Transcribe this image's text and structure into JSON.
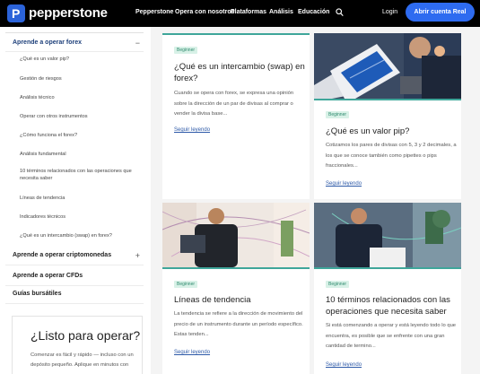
{
  "nav": {
    "brand": "pepperstone",
    "logo_letter": "P",
    "links": [
      "Pepperstone",
      "Opera con nosotros",
      "Plataformas",
      "Análisis",
      "Educación"
    ],
    "login": "Login",
    "cta": "Abrir cuenta Real"
  },
  "sidebar": {
    "sections": [
      {
        "label": "Aprende a operar forex",
        "toggle": "−",
        "expanded": true
      },
      {
        "label": "Aprende a operar criptomonedas",
        "toggle": "+"
      },
      {
        "label": "Aprende a operar CFDs",
        "toggle": ""
      },
      {
        "label": "Guías bursátiles",
        "toggle": ""
      }
    ],
    "items": [
      "¿Qué es un valor pip?",
      "Gestión de riesgos",
      "Análisis técnico",
      "Operar con otros instrumentos",
      "¿Cómo funciona el forex?",
      "Análisis fundamental",
      "10 términos relacionados con las operaciones que necesita saber",
      "Líneas de tendencia",
      "Indicadores técnicos",
      "¿Qué es un intercambio (swap) en forex?"
    ],
    "promo": {
      "title": "¿Listo para operar?",
      "text": "Comenzar es fácil y rápido — incluso con un depósito pequeño. Aplique en minutos con"
    }
  },
  "articles": [
    {
      "badge": "Beginner",
      "title": "¿Qué es un intercambio (swap) en forex?",
      "text": "Cuando se opera con forex, se expresa una opinión sobre la dirección de un par de divisas al comprar o vender la divisa base...",
      "link": "Seguir leyendo"
    },
    {
      "badge": "Beginner",
      "title": "¿Qué es un valor pip?",
      "text": "Cotizamos los pares de divisas con 5, 3 y 2 decimales, a los que se conoce también como pipettes o pips fraccionales...",
      "link": "Seguir leyendo"
    },
    {
      "badge": "Beginner",
      "title": "Líneas de tendencia",
      "text": "La tendencia se refiere a la dirección de movimiento del precio de un instrumento durante un período específico. Estas tenden...",
      "link": "Seguir leyendo"
    },
    {
      "badge": "Beginner",
      "title": "10 términos relacionados con las operaciones que necesita saber",
      "text": "Si está comenzando a operar y está leyendo todo lo que encuentra, es posible que se enfrente con una gran cantidad de termino...",
      "link": "Seguir leyendo"
    }
  ],
  "colors": {
    "accent": "#2e6bf0",
    "badge_bg": "#d8f1e7",
    "badge_text": "#2f8a6e",
    "card_bar": "#3fa69a",
    "link": "#2e5aa8"
  }
}
